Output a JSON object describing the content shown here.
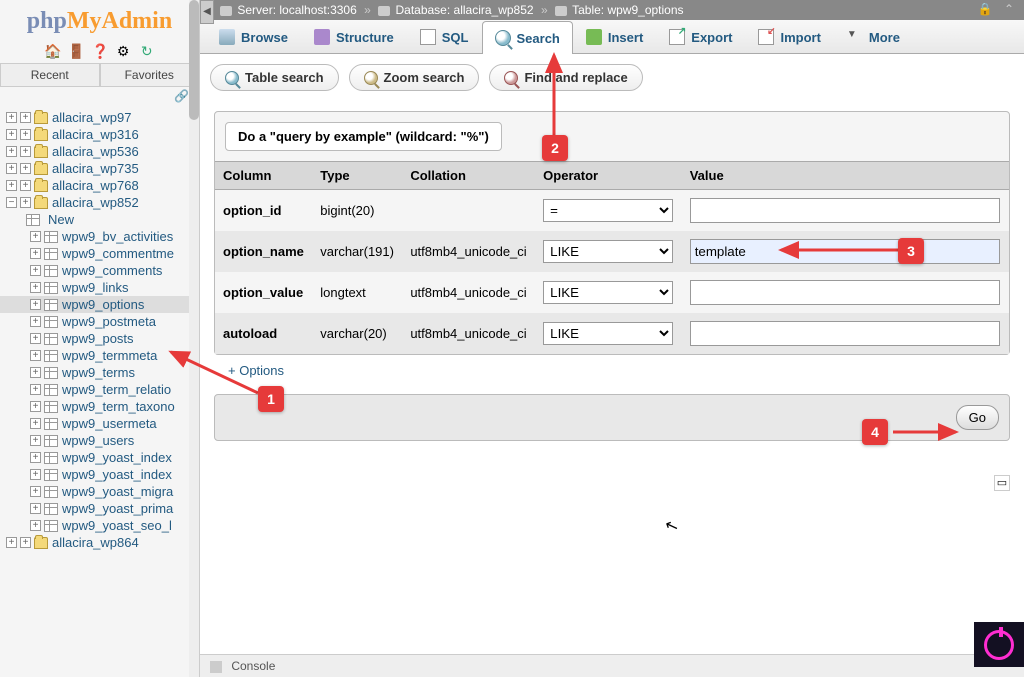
{
  "logo": {
    "part1": "php",
    "part2": "MyAdmin"
  },
  "logo_icons": {
    "home": "🏠",
    "exit": "🚪",
    "docs": "❓",
    "settings": "⚙",
    "reload": "↻"
  },
  "panel_tabs": {
    "recent": "Recent",
    "favorites": "Favorites"
  },
  "link_icon": "🔗",
  "tree": {
    "databases": [
      {
        "name": "allacira_wp97",
        "expanded": false
      },
      {
        "name": "allacira_wp316",
        "expanded": false
      },
      {
        "name": "allacira_wp536",
        "expanded": false
      },
      {
        "name": "allacira_wp735",
        "expanded": false
      },
      {
        "name": "allacira_wp768",
        "expanded": false
      },
      {
        "name": "allacira_wp852",
        "expanded": true,
        "new_label": "New",
        "tables": [
          "wpw9_bv_activities",
          "wpw9_commentme",
          "wpw9_comments",
          "wpw9_links",
          "wpw9_options",
          "wpw9_postmeta",
          "wpw9_posts",
          "wpw9_termmeta",
          "wpw9_terms",
          "wpw9_term_relatio",
          "wpw9_term_taxono",
          "wpw9_usermeta",
          "wpw9_users",
          "wpw9_yoast_index",
          "wpw9_yoast_index",
          "wpw9_yoast_migra",
          "wpw9_yoast_prima",
          "wpw9_yoast_seo_l"
        ],
        "selected_table": "wpw9_options"
      },
      {
        "name": "allacira_wp864",
        "expanded": false
      }
    ]
  },
  "breadcrumb": {
    "server_label": "Server:",
    "server": "localhost:3306",
    "db_label": "Database:",
    "db": "allacira_wp852",
    "table_label": "Table:",
    "table": "wpw9_options",
    "lock": "🔒",
    "collapse": "⌃"
  },
  "main_tabs": {
    "browse": "Browse",
    "structure": "Structure",
    "sql": "SQL",
    "search": "Search",
    "insert": "Insert",
    "export": "Export",
    "import": "Import",
    "more": "More",
    "active": "search"
  },
  "sub_tabs": {
    "table_search": "Table search",
    "zoom_search": "Zoom search",
    "find_replace": "Find and replace"
  },
  "query_box": {
    "header": "Do a \"query by example\" (wildcard: \"%\")",
    "columns": {
      "column": "Column",
      "type": "Type",
      "collation": "Collation",
      "operator": "Operator",
      "value": "Value"
    },
    "rows": [
      {
        "column": "option_id",
        "type": "bigint(20)",
        "collation": "",
        "operator": "=",
        "value": ""
      },
      {
        "column": "option_name",
        "type": "varchar(191)",
        "collation": "utf8mb4_unicode_ci",
        "operator": "LIKE",
        "value": "template",
        "highlighted": true
      },
      {
        "column": "option_value",
        "type": "longtext",
        "collation": "utf8mb4_unicode_ci",
        "operator": "LIKE",
        "value": ""
      },
      {
        "column": "autoload",
        "type": "varchar(20)",
        "collation": "utf8mb4_unicode_ci",
        "operator": "LIKE",
        "value": ""
      }
    ]
  },
  "options_link": "+ Options",
  "go_button": "Go",
  "console": "Console",
  "annotations": {
    "b1": "1",
    "b2": "2",
    "b3": "3",
    "b4": "4"
  },
  "collapse_handle": "◀",
  "cursor": "↖"
}
